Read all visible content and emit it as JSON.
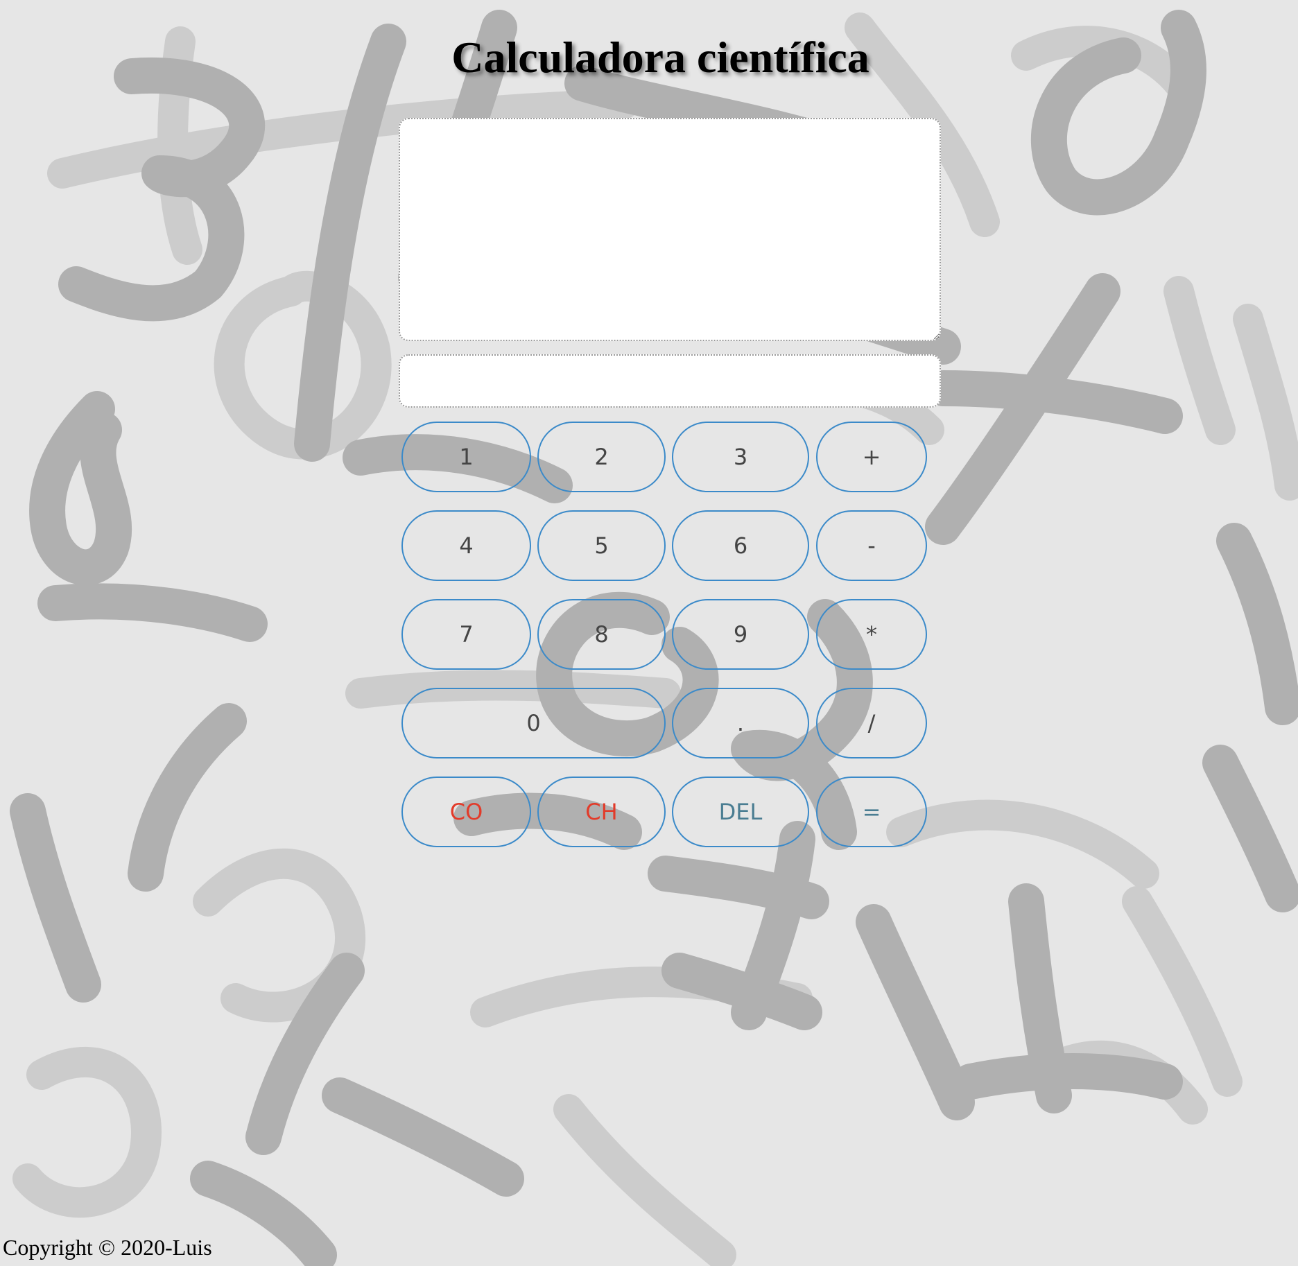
{
  "header": {
    "title": "Calculadora científica"
  },
  "display": {
    "history_value": "",
    "entry_value": ""
  },
  "keypad": {
    "rows": [
      [
        {
          "label": "1",
          "name": "key-1-button"
        },
        {
          "label": "2",
          "name": "key-2-button"
        },
        {
          "label": "3",
          "name": "key-3-button"
        },
        {
          "label": "+",
          "name": "key-plus-button"
        }
      ],
      [
        {
          "label": "4",
          "name": "key-4-button"
        },
        {
          "label": "5",
          "name": "key-5-button"
        },
        {
          "label": "6",
          "name": "key-6-button"
        },
        {
          "label": "-",
          "name": "key-minus-button"
        }
      ],
      [
        {
          "label": "7",
          "name": "key-7-button"
        },
        {
          "label": "8",
          "name": "key-8-button"
        },
        {
          "label": "9",
          "name": "key-9-button"
        },
        {
          "label": "*",
          "name": "key-multiply-button"
        }
      ],
      [
        {
          "label": "0",
          "name": "key-0-button"
        },
        {
          "label": ".",
          "name": "key-decimal-button"
        },
        {
          "label": "/",
          "name": "key-divide-button"
        }
      ],
      [
        {
          "label": "CO",
          "name": "key-co-button",
          "color": "#e23b2a"
        },
        {
          "label": "CH",
          "name": "key-ch-button",
          "color": "#e23b2a"
        },
        {
          "label": "DEL",
          "name": "key-del-button",
          "color": "#4a7d92"
        },
        {
          "label": "=",
          "name": "key-equals-button",
          "color": "#4a7d92"
        }
      ]
    ]
  },
  "colors": {
    "page_background": "#e6e6e6",
    "button_border": "#3b8ac9",
    "button_text": "#444444",
    "clear_text": "#e23b2a",
    "delete_text": "#4a7d92"
  },
  "footer": {
    "copyright": "Copyright © 2020-Luis"
  }
}
